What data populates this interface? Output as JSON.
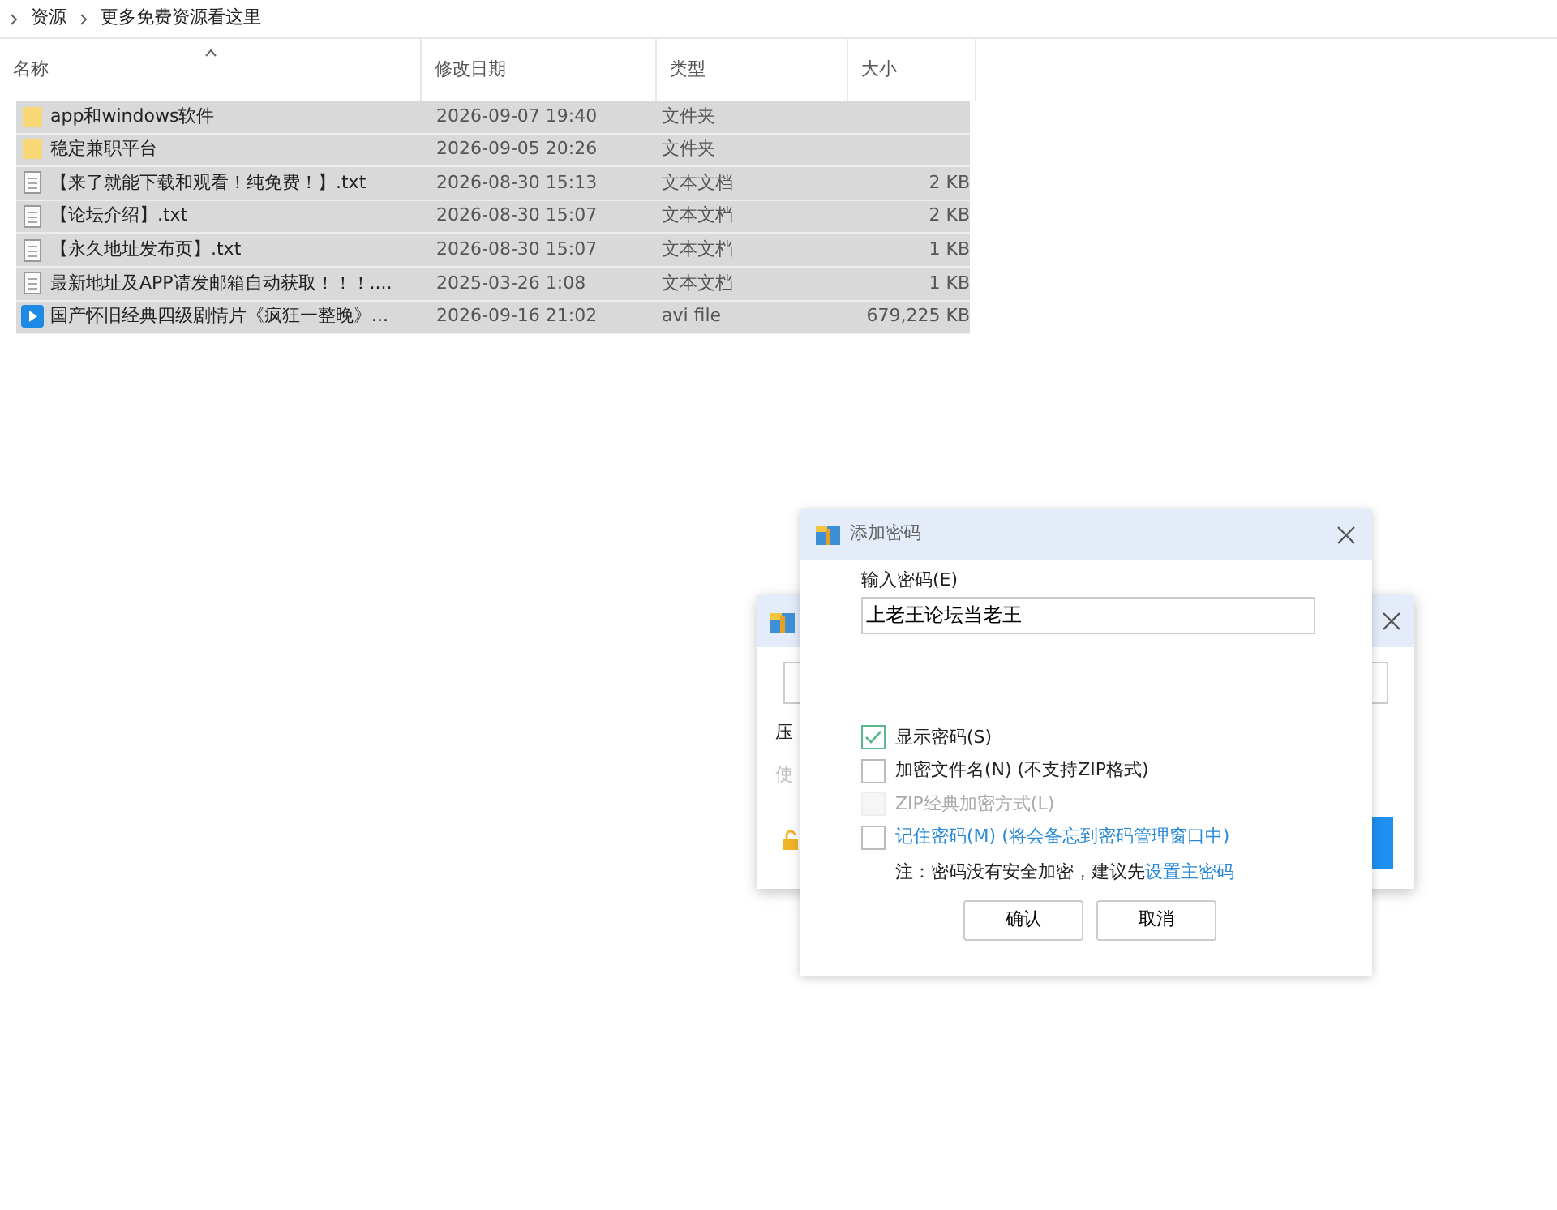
{
  "breadcrumb": [
    "资源",
    "更多免费资源看这里"
  ],
  "columns": [
    {
      "label": "名称",
      "sorted": true
    },
    {
      "label": "修改日期",
      "sorted": false
    },
    {
      "label": "类型",
      "sorted": false
    },
    {
      "label": "大小",
      "sorted": false
    }
  ],
  "files": [
    {
      "kind": "folder",
      "name": "app和windows软件",
      "modified": "2026-09-07 19:40",
      "type": "文件夹",
      "selected": true
    },
    {
      "kind": "folder",
      "name": "稳定兼职平台",
      "modified": "2026-09-05 20:26",
      "type": "文件夹",
      "selected": true
    },
    {
      "kind": "text",
      "name": "【来了就能下载和观看！纯免费！】.txt",
      "modified": "2026-08-30 15:13",
      "type": "文本文档",
      "size": "2 KB",
      "selected": true
    },
    {
      "kind": "text",
      "name": "【论坛介绍】.txt",
      "modified": "2026-08-30 15:07",
      "type": "文本文档",
      "size": "2 KB",
      "selected": true
    },
    {
      "kind": "text",
      "name": "【永久地址发布页】.txt",
      "modified": "2026-08-30 15:07",
      "type": "文本文档",
      "size": "1 KB",
      "selected": true
    },
    {
      "kind": "text",
      "name": "最新地址及APP请发邮箱自动获取！！！....",
      "modified": "2025-03-26 1:08",
      "type": "文本文档",
      "size": "1 KB",
      "selected": true
    },
    {
      "kind": "video",
      "name": "国产怀旧经典四级剧情片《疯狂一整晚》...",
      "modified": "2026-09-16 21:02",
      "type": "avi file",
      "size": "679,225 KB",
      "selected": true
    }
  ],
  "back_dialog": {
    "label": "压",
    "hint": "使"
  },
  "password_dialog": {
    "title": "添加密码",
    "input_label": "输入密码(E)",
    "input_value": "上老王论坛当老王",
    "options": [
      {
        "label": "显示密码(S)",
        "checked": true,
        "disabled": false,
        "link": false
      },
      {
        "label": "加密文件名(N) (不支持ZIP格式)",
        "checked": false,
        "disabled": false,
        "link": false
      },
      {
        "label": "ZIP经典加密方式(L)",
        "checked": false,
        "disabled": true,
        "link": false
      },
      {
        "label": "记住密码(M) (将会备忘到密码管理窗口中)",
        "checked": false,
        "disabled": false,
        "link": true
      }
    ],
    "note": "注：密码没有安全加密，建议先",
    "note_link": "设置主密码",
    "buttons": [
      "确认",
      "取消"
    ]
  }
}
